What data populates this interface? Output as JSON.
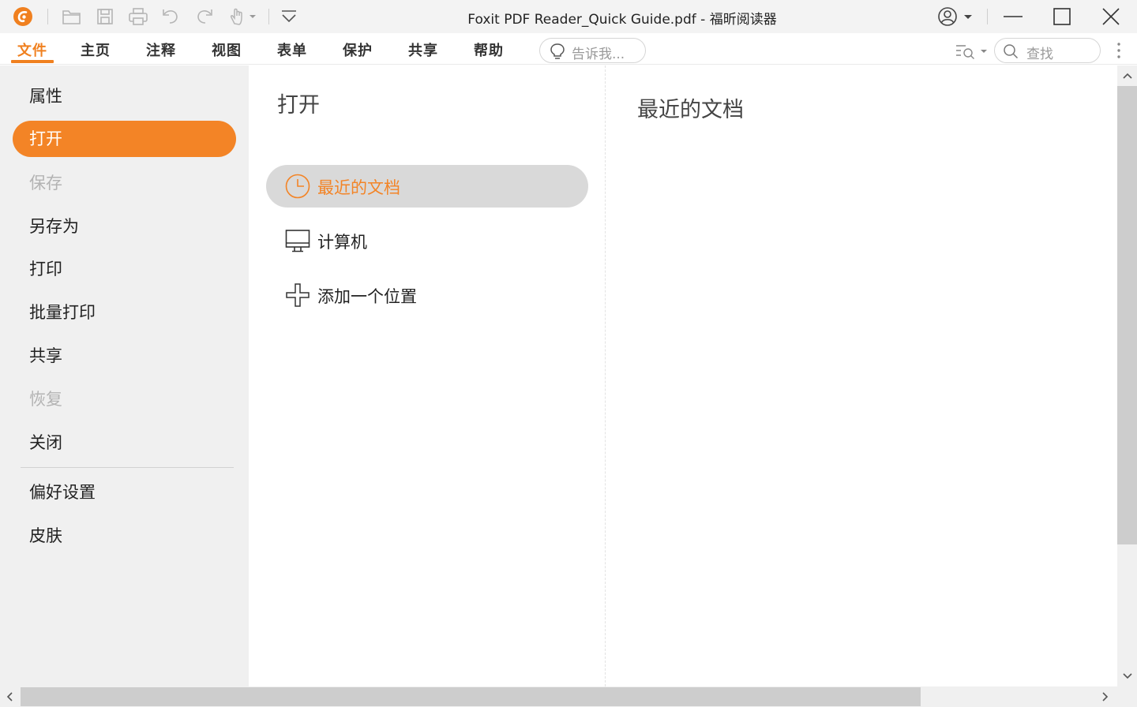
{
  "window": {
    "title": "Foxit PDF Reader_Quick Guide.pdf - 福昕阅读器"
  },
  "ribbon": {
    "tabs": [
      {
        "label": "文件",
        "active": true
      },
      {
        "label": "主页"
      },
      {
        "label": "注释"
      },
      {
        "label": "视图"
      },
      {
        "label": "表单"
      },
      {
        "label": "保护"
      },
      {
        "label": "共享"
      },
      {
        "label": "帮助"
      }
    ],
    "tell_me_placeholder": "告诉我...",
    "search_placeholder": "查找"
  },
  "file_menu": {
    "items": [
      {
        "label": "属性",
        "state": "normal"
      },
      {
        "label": "打开",
        "state": "active"
      },
      {
        "label": "保存",
        "state": "disabled"
      },
      {
        "label": "另存为",
        "state": "normal"
      },
      {
        "label": "打印",
        "state": "normal"
      },
      {
        "label": "批量打印",
        "state": "normal"
      },
      {
        "label": "共享",
        "state": "normal"
      },
      {
        "label": "恢复",
        "state": "disabled"
      },
      {
        "label": "关闭",
        "state": "normal"
      },
      {
        "label": "偏好设置",
        "state": "normal"
      },
      {
        "label": "皮肤",
        "state": "normal"
      }
    ]
  },
  "open_panel": {
    "title": "打开",
    "locations": [
      {
        "label": "最近的文档",
        "icon": "clock-icon",
        "selected": true
      },
      {
        "label": "计算机",
        "icon": "computer-icon"
      },
      {
        "label": "添加一个位置",
        "icon": "plus-icon"
      }
    ]
  },
  "recent_panel": {
    "title": "最近的文档"
  },
  "colors": {
    "accent": "#f38426",
    "nav_background": "#f0f0f0",
    "selected_location": "#d9d9d9"
  }
}
